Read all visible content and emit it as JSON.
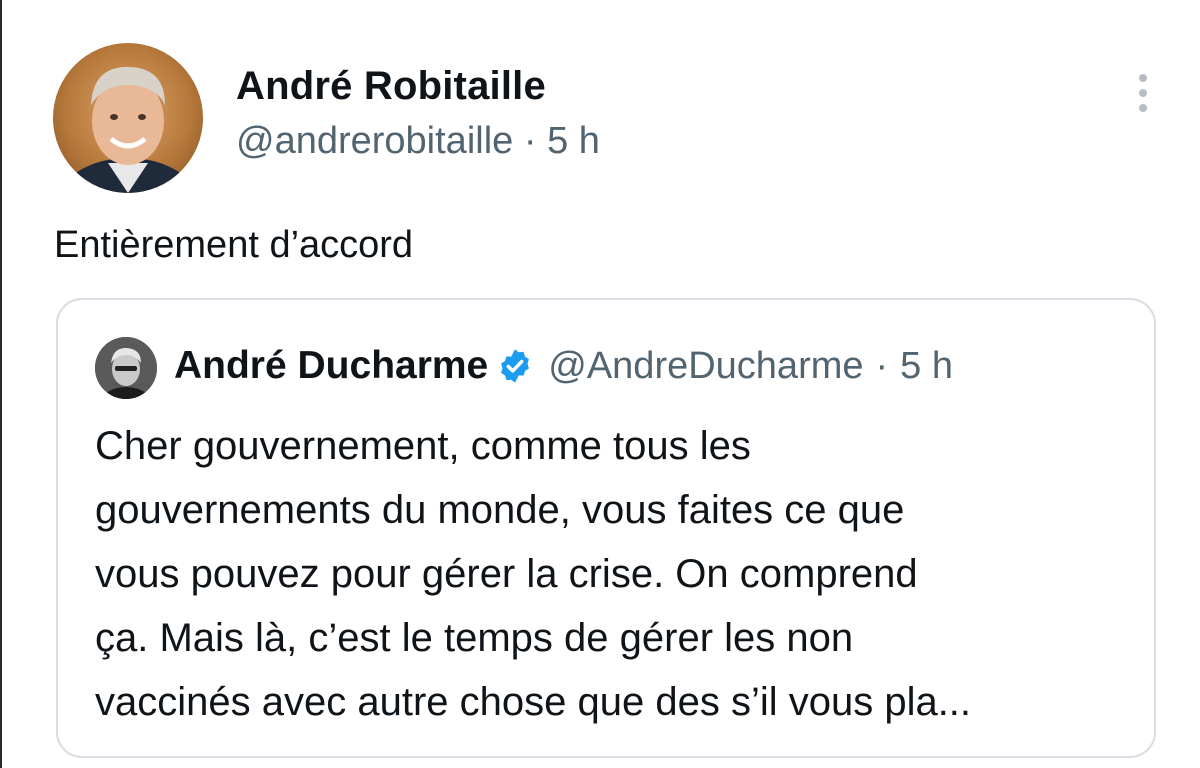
{
  "tweet": {
    "author_name": "André Robitaille",
    "author_handle": "@andrerobitaille",
    "separator": "·",
    "time": "5 h",
    "text": "Entièrement d’accord"
  },
  "quoted": {
    "author_name": "André Ducharme",
    "author_handle": "@AndreDucharme",
    "separator": "·",
    "time": "5 h",
    "verified": true,
    "text": "Cher gouvernement, comme tous les\ngouvernements du monde, vous faites ce que\nvous pouvez pour gérer la crise. On comprend\nça. Mais là, c’est le temps de gérer les non\nvaccinés avec autre chose que des s’il vous pla..."
  },
  "icons": {
    "more": "more-vertical-icon",
    "verified": "verified-badge-icon"
  },
  "colors": {
    "secondary_text": "#536471",
    "verified_blue": "#1d9bf0",
    "card_border": "#d7dde2"
  }
}
